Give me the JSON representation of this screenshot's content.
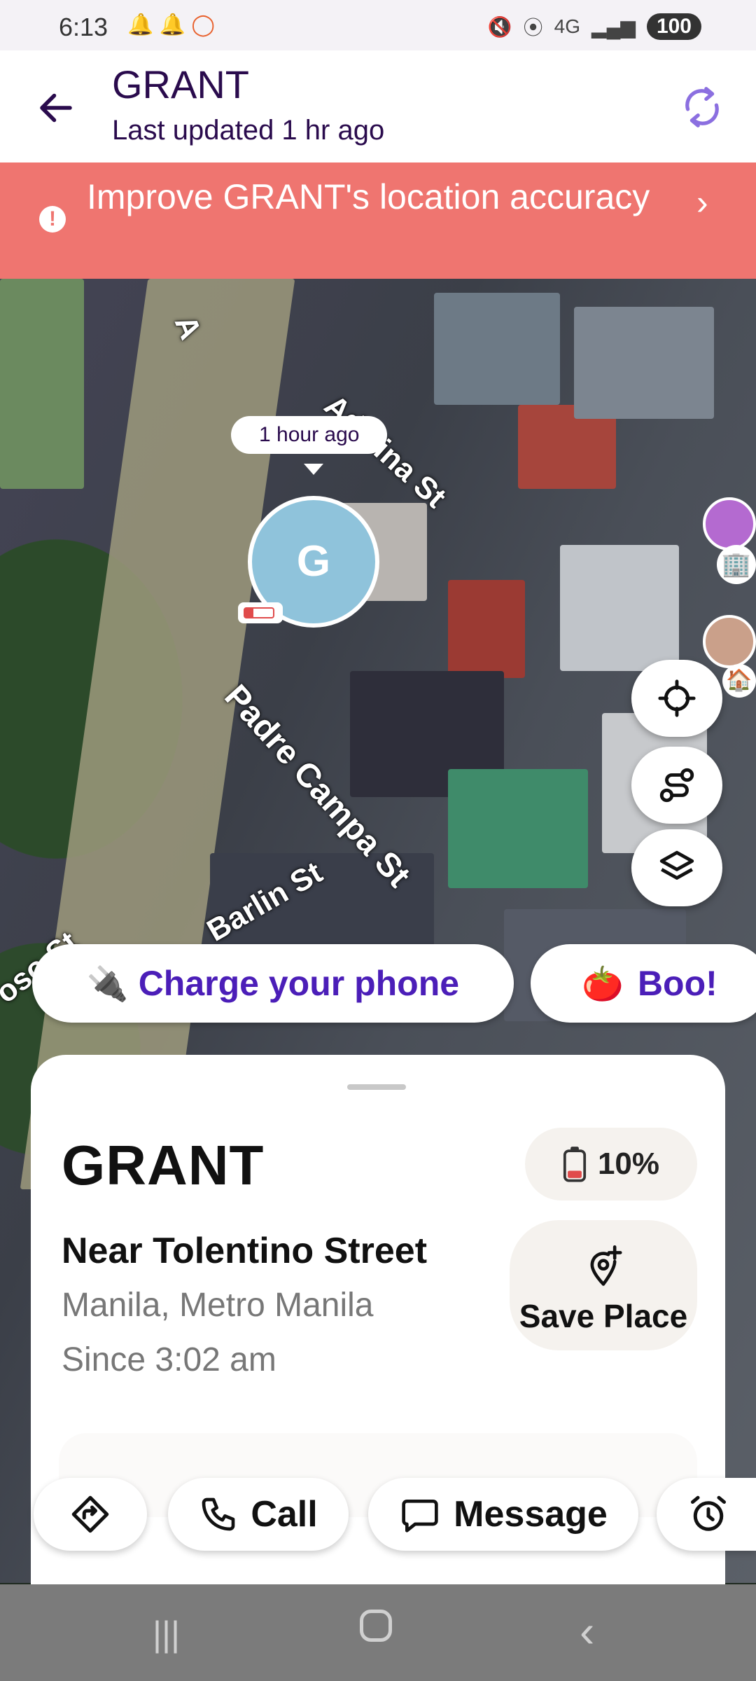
{
  "status_bar": {
    "time": "6:13",
    "signal": "4G",
    "battery": "100"
  },
  "header": {
    "title": "GRANT",
    "subtitle": "Last updated 1 hr ago"
  },
  "banner": {
    "text": "Improve GRANT's location accuracy"
  },
  "map": {
    "marker_time": "1 hour ago",
    "marker_initial": "G",
    "streets": [
      "Adelina St",
      "Padre Campa St",
      "Barlin St",
      "oso St",
      "A"
    ]
  },
  "chips": {
    "charge": "Charge your phone",
    "boo": "Boo!"
  },
  "sheet": {
    "name": "GRANT",
    "battery": "10%",
    "location": "Near Tolentino Street",
    "city": "Manila, Metro Manila",
    "since": "Since 3:02 am",
    "save_place": "Save Place"
  },
  "actions": {
    "call": "Call",
    "message": "Message"
  }
}
